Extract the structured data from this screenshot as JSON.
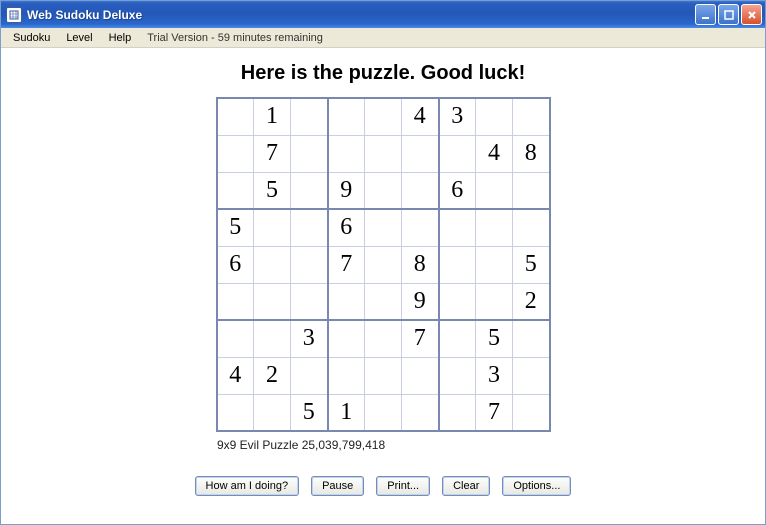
{
  "window": {
    "title": "Web Sudoku Deluxe"
  },
  "menu": {
    "items": [
      "Sudoku",
      "Level",
      "Help"
    ],
    "trial": "Trial Version - 59 minutes remaining"
  },
  "heading": "Here is the puzzle. Good luck!",
  "grid": [
    [
      "",
      "1",
      "",
      "",
      "",
      "4",
      "3",
      "",
      ""
    ],
    [
      "",
      "7",
      "",
      "",
      "",
      "",
      "",
      "4",
      "8"
    ],
    [
      "",
      "5",
      "",
      "9",
      "",
      "",
      "6",
      "",
      ""
    ],
    [
      "5",
      "",
      "",
      "6",
      "",
      "",
      "",
      "",
      ""
    ],
    [
      "6",
      "",
      "",
      "7",
      "",
      "8",
      "",
      "",
      "5"
    ],
    [
      "",
      "",
      "",
      "",
      "",
      "9",
      "",
      "",
      "2"
    ],
    [
      "",
      "",
      "3",
      "",
      "",
      "7",
      "",
      "5",
      ""
    ],
    [
      "4",
      "2",
      "",
      "",
      "",
      "",
      "",
      "3",
      ""
    ],
    [
      "",
      "",
      "5",
      "1",
      "",
      "",
      "",
      "7",
      ""
    ]
  ],
  "puzzle_info": "9x9 Evil Puzzle 25,039,799,418",
  "buttons": {
    "how": "How am I doing?",
    "pause": "Pause",
    "print": "Print...",
    "clear": "Clear",
    "options": "Options..."
  }
}
